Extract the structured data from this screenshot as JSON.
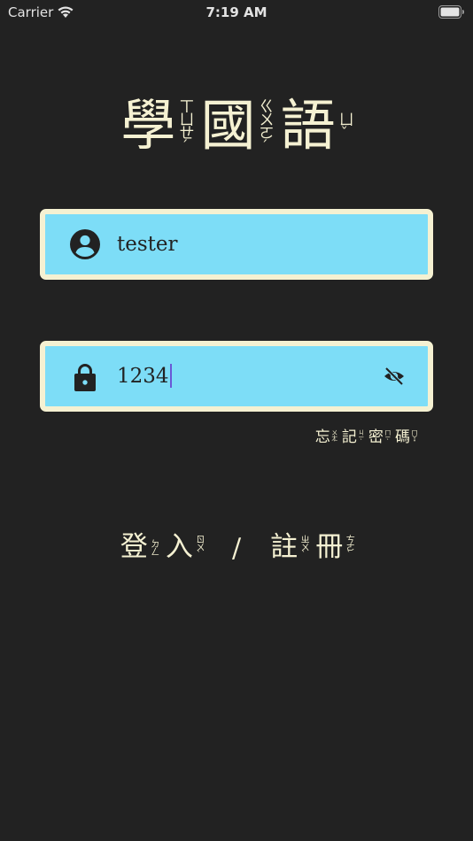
{
  "status_bar": {
    "carrier": "Carrier",
    "time": "7:19 AM"
  },
  "title": {
    "chars": [
      {
        "char": "學",
        "zhuyin": "ㄒㄩㄝˊ"
      },
      {
        "char": "國",
        "zhuyin": "ㄍㄨㄛˊ"
      },
      {
        "char": "語",
        "zhuyin": "ㄩˇ"
      }
    ]
  },
  "username_field": {
    "value": "tester",
    "icon": "account-circle-icon"
  },
  "password_field": {
    "value": "1234",
    "icon": "lock-icon",
    "toggle_icon": "eye-off-icon"
  },
  "forgot_password": {
    "chars": [
      {
        "char": "忘",
        "zhuyin": "ㄨㄤˋ"
      },
      {
        "char": "記",
        "zhuyin": "ㄐㄧˋ"
      },
      {
        "char": "密",
        "zhuyin": "ㄇㄧˋ"
      },
      {
        "char": "碼",
        "zhuyin": "ㄇㄚˇ"
      }
    ]
  },
  "login": {
    "chars": [
      {
        "char": "登",
        "zhuyin": "ㄉㄥ"
      },
      {
        "char": "入",
        "zhuyin": "ㄖㄨˋ"
      }
    ]
  },
  "separator": "/",
  "register": {
    "chars": [
      {
        "char": "註",
        "zhuyin": "ㄓㄨˋ"
      },
      {
        "char": "冊",
        "zhuyin": "ㄘㄜˋ"
      }
    ]
  },
  "colors": {
    "background": "#222222",
    "field_fill": "#7dddf7",
    "field_border": "#f5f1d2",
    "text_cream": "#f5f1d2",
    "caret": "#6a58d6"
  }
}
